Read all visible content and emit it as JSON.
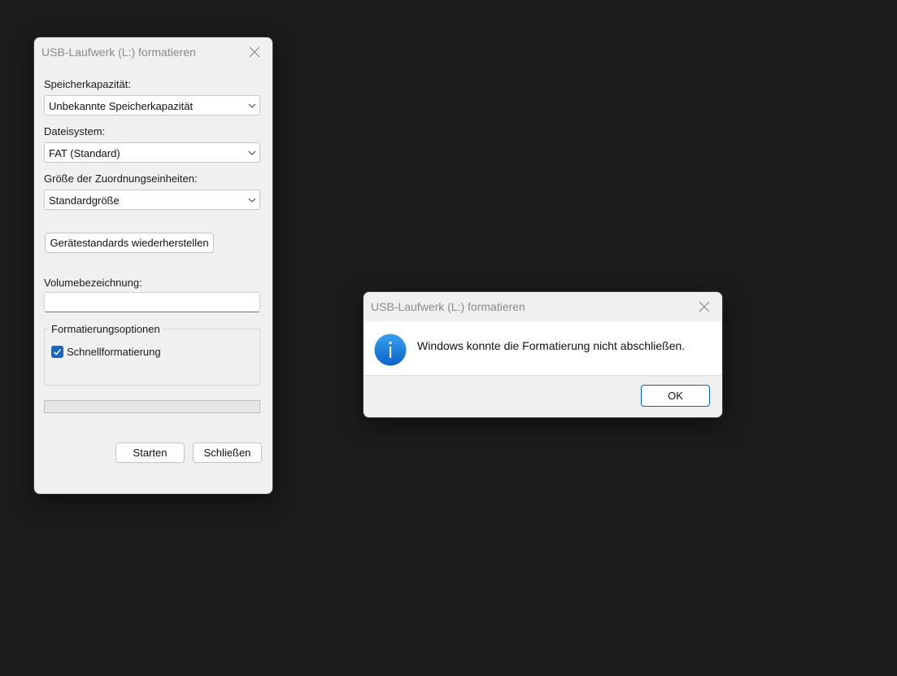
{
  "format_dialog": {
    "title": "USB-Laufwerk (L:) formatieren",
    "capacity": {
      "label": "Speicherkapazität:",
      "value": "Unbekannte Speicherkapazität"
    },
    "filesystem": {
      "label": "Dateisystem:",
      "value": "FAT (Standard)"
    },
    "alloc_size": {
      "label": "Größe der Zuordnungseinheiten:",
      "value": "Standardgröße"
    },
    "restore_defaults_label": "Gerätestandards wiederherstellen",
    "volume_label": {
      "label": "Volumebezeichnung:",
      "value": ""
    },
    "format_options": {
      "legend": "Formatierungsoptionen",
      "quick_format_label": "Schnellformatierung",
      "quick_format_checked": true
    },
    "progress": 0,
    "start_label": "Starten",
    "close_label": "Schließen"
  },
  "message_box": {
    "title": "USB-Laufwerk (L:) formatieren",
    "icon": "info-icon",
    "message": "Windows konnte die Formatierung nicht abschließen.",
    "ok_label": "OK"
  },
  "colors": {
    "desktop": "#1c1c1c",
    "dialog_bg": "#f0f0f0",
    "accent": "#1766c0",
    "default_button_border": "#0067c0"
  }
}
